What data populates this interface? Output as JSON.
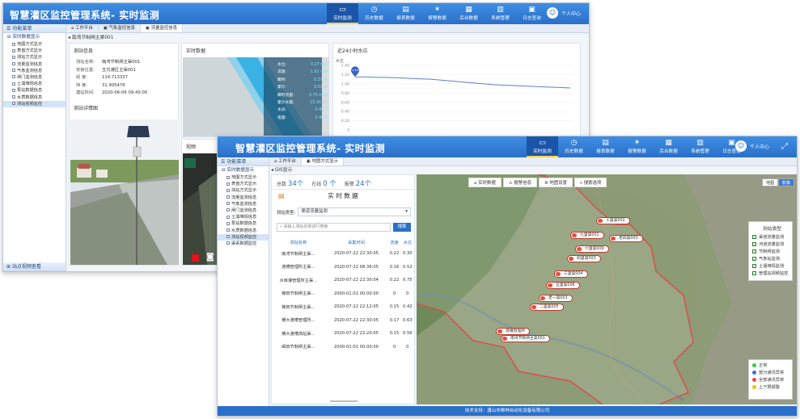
{
  "nav_items": [
    {
      "label": "实时监测",
      "icon": "monitor-icon",
      "glyph": "▭"
    },
    {
      "label": "历史数据",
      "icon": "history-icon",
      "glyph": "◷"
    },
    {
      "label": "报表数据",
      "icon": "report-icon",
      "glyph": "▤"
    },
    {
      "label": "报警数据",
      "icon": "alarm-icon",
      "glyph": "✶"
    },
    {
      "label": "后台数据",
      "icon": "backend-icon",
      "glyph": "▦"
    },
    {
      "label": "系统管理",
      "icon": "system-icon",
      "glyph": "▥"
    },
    {
      "label": "日志查询",
      "icon": "log-icon",
      "glyph": "▣"
    }
  ],
  "back": {
    "title": "智慧灌区监控管理系统- 实时监测",
    "user": "个人中心",
    "sidebar_title": "功能菜单",
    "sidebar_group": "实时数据显示",
    "sidebar_items": [
      "地图方式显示",
      "表盘方式显示",
      "测站方式显示",
      "流量监测信息",
      "气象监测信息",
      "闸门监测信息",
      "土壤墒情信息",
      "泵站数据信息",
      "水质数据信息",
      "测站视频监控"
    ],
    "sidebar_selected": 9,
    "sidebar_bottom": "站点视频查看",
    "tabs": [
      "工作平台",
      "气象监控信息",
      "流量监控信息"
    ],
    "breadcrumb": "南湾节制闸主渠001",
    "station_info_title": "测站信息",
    "station_info": [
      {
        "k": "测站名称:",
        "v": "南湾节制闸主渠001"
      },
      {
        "k": "安装位置:",
        "v": "五坑灌区主渠001"
      },
      {
        "k": "经    度:",
        "v": "114.713337"
      },
      {
        "k": "纬    度:",
        "v": "31.905476"
      },
      {
        "k": "建站时间:",
        "v": "2020-06-06 09:40:00"
      }
    ],
    "station_photo_title": "测站详情图",
    "realtime_title": "实时数据",
    "overlay": [
      {
        "k": "水位:",
        "v": "0.27 m/s"
      },
      {
        "k": "流速:",
        "v": "1.81 m/s"
      },
      {
        "k": "瞬时:",
        "v": "0.37 m"
      },
      {
        "k": "累计:",
        "v": "0.53 m"
      },
      {
        "k": "瞬时流量:",
        "v": "0.75 m³/s"
      },
      {
        "k": "累计水量:",
        "v": "15.34 m³"
      },
      {
        "k": "水深:",
        "v": "0.40 V"
      },
      {
        "k": "电量:",
        "v": "0.40 V"
      }
    ],
    "video_title": "视频",
    "chart_title": "近24小时水位"
  },
  "chart_data": {
    "type": "line",
    "ylabel": "水位",
    "ylim": [
      0,
      1.4
    ],
    "yticks": [
      "1.40",
      "1.20",
      "1.00",
      "0.80",
      "0.60",
      "0.40",
      "0.20",
      "0"
    ],
    "marker_label": "1.43",
    "series": [
      {
        "values": [
          1.15,
          1.15,
          1.14,
          1.14,
          1.13,
          1.12,
          1.11,
          1.1,
          1.08,
          1.06,
          1.04,
          1.02,
          1.0,
          0.98,
          0.97,
          0.96,
          0.95,
          0.94,
          0.93,
          0.92,
          0.91
        ]
      }
    ]
  },
  "front": {
    "title": "智慧灌区监控管理系统- 实时监测",
    "user": "个人中心",
    "sidebar_title": "功能菜单",
    "sidebar_group": "实时数据显示",
    "sidebar_items": [
      "地图方式显示",
      "表盘方式显示",
      "测站方式显示",
      "流量监测信息",
      "气象监测信息",
      "闸门监测信息",
      "土壤墒情信息",
      "泵站数据信息",
      "水质数据信息",
      "测站视频监控",
      "渠系数据监控"
    ],
    "sidebar_selected": 9,
    "tabs": [
      "工作平台",
      "地图方式显示"
    ],
    "gis_title": "GIS显示",
    "counts": [
      {
        "label": "总数",
        "value": "34个"
      },
      {
        "label": "在线",
        "value": "0 个"
      },
      {
        "label": "报警",
        "value": "24个"
      }
    ],
    "list_title": "实 时 数 据",
    "filter_label": "测站类型:",
    "filter_value": "渠道流量监测",
    "search_placeholder": "请输入测站名称进行搜索",
    "search_button": "搜索",
    "columns": [
      "测站名称",
      "采集时间",
      "流速",
      "水位"
    ],
    "rows": [
      [
        "南湾节制闸主渠...",
        "2020-07-22 22:30:05",
        "0.22",
        "0.30"
      ],
      [
        "渡槽管理所主渠...",
        "2020-07-22 08:36:05",
        "0.16",
        "0.52"
      ],
      [
        "水库灌管理所主渠...",
        "2020-07-22 22:30:04",
        "0.22",
        "0.75"
      ],
      [
        "梯田节制闸主渠...",
        "2000-01-01 00:00:00",
        "0",
        "0"
      ],
      [
        "梯田节制闸主渠...",
        "2020-07-22 22:12:05",
        "0.15",
        "0.42"
      ],
      [
        "横大渡槽管理所...",
        "2020-07-22 22:30:05",
        "0.17",
        "0.63"
      ],
      [
        "横大渡槽测站渠...",
        "2020-07-22 22:20:05",
        "0.15",
        "0.56"
      ],
      [
        "闽田节制闸主渠...",
        "2000-01-01 00:00:00",
        "0",
        "0"
      ]
    ],
    "map_tools": [
      "实时数据",
      "报警信息",
      "地图设置",
      "搜索选项"
    ],
    "map_tool_icons": [
      "monitor-icon",
      "alarm-icon",
      "settings-icon",
      "search-icon"
    ],
    "map_tool_glyphs": [
      "⌂",
      "⚠",
      "⚙",
      "⌕"
    ],
    "map_types": [
      "地图",
      "影像"
    ],
    "markers": [
      "十里渠002",
      "九里渠001",
      "老四渠003",
      "六里渠009",
      "四里渠003",
      "三里渠004",
      "五里渠006",
      "老一渠003",
      "二里渠005",
      "渡槽管理所",
      "南湾节制闸主渠001"
    ],
    "legend_title": "测站类型",
    "legend_items": [
      "渠道流量监测",
      "河道流量监测",
      "节制闸监测",
      "气象站监测",
      "土壤墒情监测",
      "管理站视频监控"
    ],
    "status_legend": [
      {
        "label": "正常",
        "color": "#2ecc40"
      },
      {
        "label": "部分通讯异常",
        "color": "#3b6fd6"
      },
      {
        "label": "全部通讯异常",
        "color": "#e74c3c"
      },
      {
        "label": "上下限报警",
        "color": "#f1c40f"
      }
    ],
    "footer": "技术支持：唐山市柳林自动化设备有限公司"
  }
}
